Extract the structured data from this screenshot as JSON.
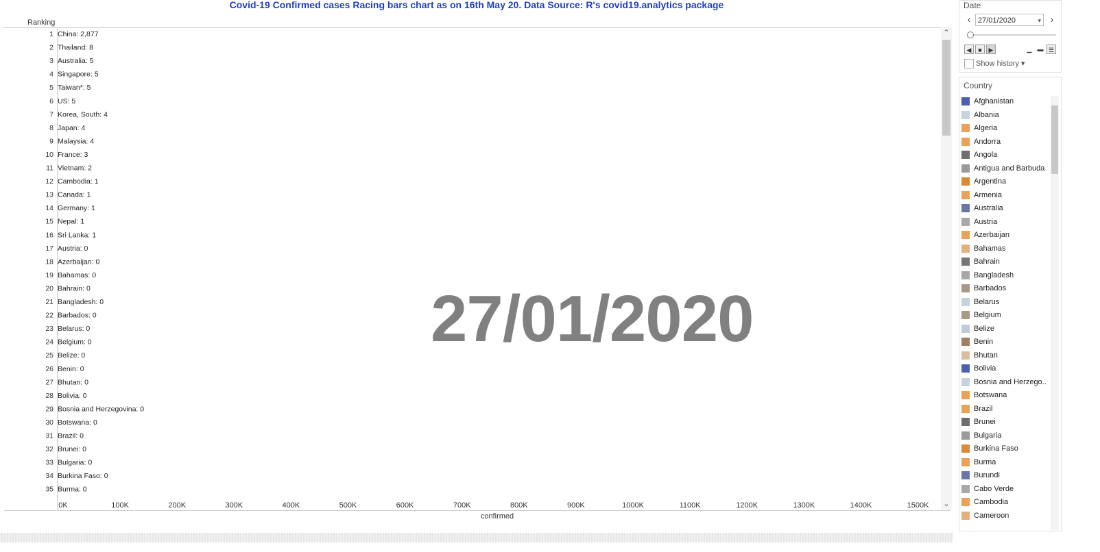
{
  "title": "Covid-19 Confirmed cases Racing bars chart as on 16th May 20. Data Source: R's covid19.analytics package",
  "ranking_header": "Ranking",
  "watermark_date": "27/01/2020",
  "x_axis_label": "confirmed",
  "x_ticks": [
    "0K",
    "100K",
    "200K",
    "300K",
    "400K",
    "500K",
    "600K",
    "700K",
    "800K",
    "900K",
    "1000K",
    "1100K",
    "1200K",
    "1300K",
    "1400K",
    "1500K"
  ],
  "rows": [
    {
      "rank": "1",
      "label": "China:  2,877"
    },
    {
      "rank": "2",
      "label": "Thailand:  8"
    },
    {
      "rank": "3",
      "label": "Australia:  5"
    },
    {
      "rank": "4",
      "label": "Singapore:  5"
    },
    {
      "rank": "5",
      "label": "Taiwan*:  5"
    },
    {
      "rank": "6",
      "label": "US:  5"
    },
    {
      "rank": "7",
      "label": "Korea, South:  4"
    },
    {
      "rank": "8",
      "label": "Japan:  4"
    },
    {
      "rank": "9",
      "label": "Malaysia:  4"
    },
    {
      "rank": "10",
      "label": "France:  3"
    },
    {
      "rank": "11",
      "label": "Vietnam:  2"
    },
    {
      "rank": "12",
      "label": "Cambodia:  1"
    },
    {
      "rank": "13",
      "label": "Canada:  1"
    },
    {
      "rank": "14",
      "label": "Germany:  1"
    },
    {
      "rank": "15",
      "label": "Nepal:  1"
    },
    {
      "rank": "16",
      "label": "Sri Lanka:  1"
    },
    {
      "rank": "17",
      "label": "Austria:  0"
    },
    {
      "rank": "18",
      "label": "Azerbaijan:  0"
    },
    {
      "rank": "19",
      "label": "Bahamas:  0"
    },
    {
      "rank": "20",
      "label": "Bahrain:  0"
    },
    {
      "rank": "21",
      "label": "Bangladesh:  0"
    },
    {
      "rank": "22",
      "label": "Barbados:  0"
    },
    {
      "rank": "23",
      "label": "Belarus:  0"
    },
    {
      "rank": "24",
      "label": "Belgium:  0"
    },
    {
      "rank": "25",
      "label": "Belize:  0"
    },
    {
      "rank": "26",
      "label": "Benin:  0"
    },
    {
      "rank": "27",
      "label": "Bhutan:  0"
    },
    {
      "rank": "28",
      "label": "Bolivia:  0"
    },
    {
      "rank": "29",
      "label": "Bosnia and Herzegovina:  0"
    },
    {
      "rank": "30",
      "label": "Botswana:  0"
    },
    {
      "rank": "31",
      "label": "Brazil:  0"
    },
    {
      "rank": "32",
      "label": "Brunei:  0"
    },
    {
      "rank": "33",
      "label": "Bulgaria:  0"
    },
    {
      "rank": "34",
      "label": "Burkina Faso:  0"
    },
    {
      "rank": "35",
      "label": "Burma:  0"
    }
  ],
  "date_filter": {
    "label": "Date",
    "value": "27/01/2020",
    "show_history": "Show history"
  },
  "legend": {
    "title": "Country",
    "items": [
      {
        "name": "Afghanistan",
        "color": "#4e5fb0"
      },
      {
        "name": "Albania",
        "color": "#c5d3df"
      },
      {
        "name": "Algeria",
        "color": "#e8a25a"
      },
      {
        "name": "Andorra",
        "color": "#e8a25a"
      },
      {
        "name": "Angola",
        "color": "#6e6e6e"
      },
      {
        "name": "Antigua and Barbuda",
        "color": "#9a9a9a"
      },
      {
        "name": "Argentina",
        "color": "#d9893a"
      },
      {
        "name": "Armenia",
        "color": "#e8a25a"
      },
      {
        "name": "Australia",
        "color": "#6a76a8"
      },
      {
        "name": "Austria",
        "color": "#a8a8a8"
      },
      {
        "name": "Azerbaijan",
        "color": "#e8a25a"
      },
      {
        "name": "Bahamas",
        "color": "#e3b07e"
      },
      {
        "name": "Bahrain",
        "color": "#777777"
      },
      {
        "name": "Bangladesh",
        "color": "#a8a8a8"
      },
      {
        "name": "Barbados",
        "color": "#a89a86"
      },
      {
        "name": "Belarus",
        "color": "#c5d3df"
      },
      {
        "name": "Belgium",
        "color": "#a89a86"
      },
      {
        "name": "Belize",
        "color": "#c0cad8"
      },
      {
        "name": "Benin",
        "color": "#9e8066"
      },
      {
        "name": "Bhutan",
        "color": "#d9bfa0"
      },
      {
        "name": "Bolivia",
        "color": "#4e5fb0"
      },
      {
        "name": "Bosnia and Herzego..",
        "color": "#c5d3df"
      },
      {
        "name": "Botswana",
        "color": "#e8a25a"
      },
      {
        "name": "Brazil",
        "color": "#e8a25a"
      },
      {
        "name": "Brunei",
        "color": "#6e6e6e"
      },
      {
        "name": "Bulgaria",
        "color": "#9a9a9a"
      },
      {
        "name": "Burkina Faso",
        "color": "#d9893a"
      },
      {
        "name": "Burma",
        "color": "#e8a25a"
      },
      {
        "name": "Burundi",
        "color": "#6a76a8"
      },
      {
        "name": "Cabo Verde",
        "color": "#a8a8a8"
      },
      {
        "name": "Cambodia",
        "color": "#e8a25a"
      },
      {
        "name": "Cameroon",
        "color": "#e3b07e"
      }
    ]
  }
}
